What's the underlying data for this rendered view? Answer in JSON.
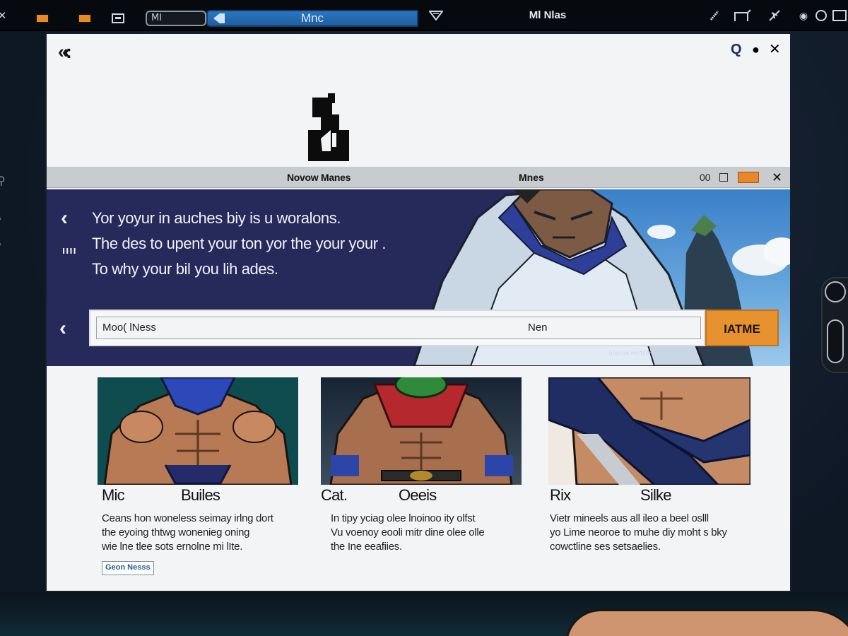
{
  "topbar": {
    "address_left": "MI",
    "address_main": "Mnc",
    "title": "Ml Nlas"
  },
  "window": {
    "subbar": {
      "left_label": "Novow Manes",
      "center_label": "Mnes",
      "right_label": "00"
    }
  },
  "hero": {
    "lines": [
      "Yor yoyur in auches biy is u woralons.",
      "The des to upent your ton yor the your your .",
      "To why your bil you lih ades."
    ],
    "menu_glyph": "ıııı",
    "search": {
      "placeholder": "Moo( lNess",
      "mid_text": "Nen"
    },
    "button_label": "IATME",
    "fine_print": "DOCTOR PATTERN"
  },
  "cards": [
    {
      "title_a": "Mic",
      "title_b": "Builes",
      "desc": [
        "Ceans hon woneless seimay irlng dort",
        "the eyoing thtwg wonenieg oning",
        "wie lne tlee sots ernolne mi lIte."
      ],
      "button": "Geon Nesss"
    },
    {
      "title_a": "Cat.",
      "title_b": "Oeeis",
      "desc": [
        "In tipy yciag olee lnoinoo ity olfst",
        "Vu voenoy eooli mitr dine olee olle",
        "the Ine eeafiies."
      ]
    },
    {
      "title_a": "Rix",
      "title_b": "Silke",
      "desc": [
        "Vietr mineels aus all ileo a beel oslll",
        "yo Lime neoroe to muhe diy moht s bky",
        "cowctline ses setsaelies."
      ]
    }
  ],
  "colors": {
    "accent_orange": "#e6922e",
    "hero_navy": "#252a5a",
    "address_blue": "#2a76c2"
  },
  "icons": [
    "orange-square-icon",
    "window-icon",
    "pin-icon",
    "triangle-down-icon",
    "edit-icon",
    "crop-icon",
    "plane-icon",
    "wifi-icon",
    "search-icon",
    "record-icon",
    "close-icon",
    "chevron-left-icon",
    "back-double-chevron-icon"
  ]
}
